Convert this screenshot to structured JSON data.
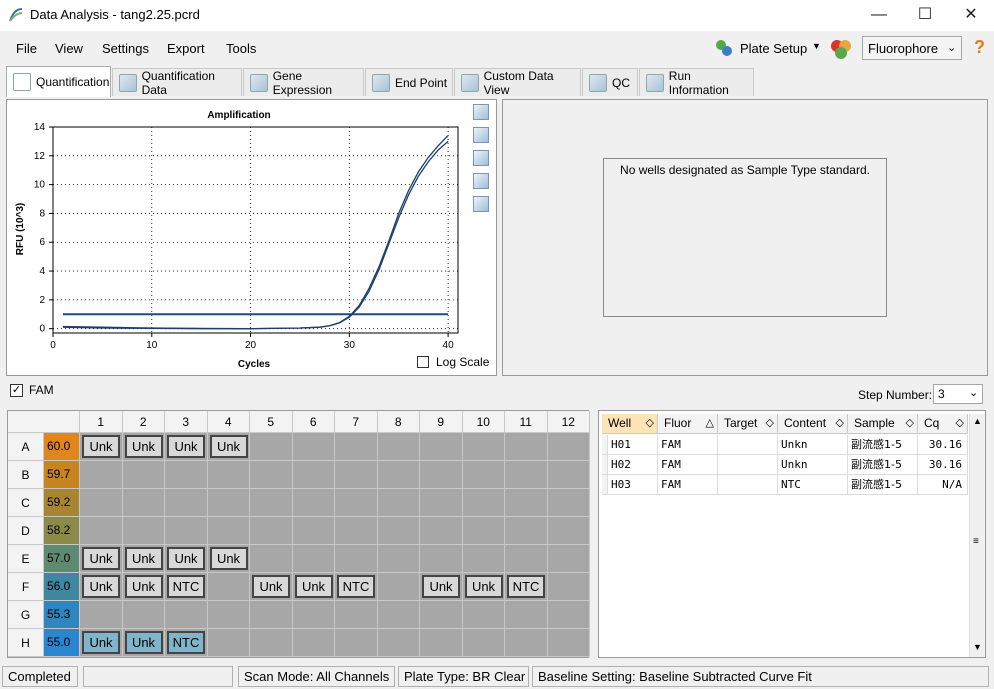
{
  "window": {
    "title": "Data Analysis - tang2.25.pcrd",
    "minimize": "—",
    "maximize": "☐",
    "close": "✕"
  },
  "menu": [
    "File",
    "View",
    "Settings",
    "Export",
    "Tools"
  ],
  "toolbar": {
    "plate_setup": "Plate Setup",
    "fluorophore": "Fluorophore",
    "help": "?"
  },
  "tabs": [
    "Quantification",
    "Quantification Data",
    "Gene Expression",
    "End Point",
    "Custom Data View",
    "QC",
    "Run Information"
  ],
  "chart_data": {
    "type": "line",
    "title": "Amplification",
    "xlabel": "Cycles",
    "ylabel": "RFU (10^3)",
    "xlim": [
      0,
      41
    ],
    "ylim": [
      -0.3,
      14
    ],
    "x_ticks": [
      0,
      10,
      20,
      30,
      40
    ],
    "y_ticks": [
      0,
      2,
      4,
      6,
      8,
      10,
      12,
      14
    ],
    "grid": true,
    "threshold": 1.0,
    "series": [
      {
        "x": [
          1,
          5,
          10,
          15,
          20,
          25,
          27,
          28,
          29,
          30,
          31,
          32,
          33,
          34,
          35,
          36,
          37,
          38,
          39,
          40
        ],
        "y": [
          0.1,
          0.05,
          0.02,
          0.0,
          0.0,
          0.05,
          0.1,
          0.2,
          0.4,
          0.8,
          1.5,
          2.6,
          4.1,
          5.9,
          7.7,
          9.3,
          10.6,
          11.6,
          12.4,
          13.0
        ]
      },
      {
        "x": [
          1,
          5,
          10,
          15,
          20,
          25,
          27,
          28,
          29,
          30,
          31,
          32,
          33,
          34,
          35,
          36,
          37,
          38,
          39,
          40
        ],
        "y": [
          0.15,
          0.1,
          0.05,
          0.02,
          0.0,
          0.05,
          0.1,
          0.2,
          0.42,
          0.85,
          1.6,
          2.8,
          4.3,
          6.1,
          8.0,
          9.6,
          10.9,
          11.9,
          12.7,
          13.4
        ]
      }
    ]
  },
  "log_scale_label": "Log Scale",
  "standard_message": "No wells designated as Sample Type standard.",
  "fam": {
    "label": "FAM",
    "checked": true
  },
  "step_number": {
    "label": "Step Number:",
    "value": "3"
  },
  "plate": {
    "columns": [
      "1",
      "2",
      "3",
      "4",
      "5",
      "6",
      "7",
      "8",
      "9",
      "10",
      "11",
      "12"
    ],
    "rows": [
      {
        "label": "A",
        "temp": "60.0",
        "color": "#e0861c",
        "wells": [
          "Unk",
          "Unk",
          "Unk",
          "Unk",
          "",
          "",
          "",
          "",
          "",
          "",
          "",
          ""
        ]
      },
      {
        "label": "B",
        "temp": "59.7",
        "color": "#c7851f",
        "wells": [
          "",
          "",
          "",
          "",
          "",
          "",
          "",
          "",
          "",
          "",
          "",
          ""
        ]
      },
      {
        "label": "C",
        "temp": "59.2",
        "color": "#a88631",
        "wells": [
          "",
          "",
          "",
          "",
          "",
          "",
          "",
          "",
          "",
          "",
          "",
          ""
        ]
      },
      {
        "label": "D",
        "temp": "58.2",
        "color": "#8c8a49",
        "wells": [
          "",
          "",
          "",
          "",
          "",
          "",
          "",
          "",
          "",
          "",
          "",
          ""
        ]
      },
      {
        "label": "E",
        "temp": "57.0",
        "color": "#5f8a72",
        "wells": [
          "Unk",
          "Unk",
          "Unk",
          "Unk",
          "",
          "",
          "",
          "",
          "",
          "",
          "",
          ""
        ]
      },
      {
        "label": "F",
        "temp": "56.0",
        "color": "#3f87a0",
        "wells": [
          "Unk",
          "Unk",
          "NTC",
          "",
          "Unk",
          "Unk",
          "NTC",
          "",
          "Unk",
          "Unk",
          "NTC",
          ""
        ]
      },
      {
        "label": "G",
        "temp": "55.3",
        "color": "#2d86c0",
        "wells": [
          "",
          "",
          "",
          "",
          "",
          "",
          "",
          "",
          "",
          "",
          "",
          ""
        ]
      },
      {
        "label": "H",
        "temp": "55.0",
        "color": "#2a86cf",
        "wells": [
          "Unk",
          "Unk",
          "NTC",
          "",
          "",
          "",
          "",
          "",
          "",
          "",
          "",
          ""
        ]
      }
    ]
  },
  "well_table": {
    "headers": [
      "Well",
      "Fluor",
      "Target",
      "Content",
      "Sample",
      "Cq"
    ],
    "rows": [
      [
        "H01",
        "FAM",
        "",
        "Unkn",
        "副流感1-5",
        "30.16"
      ],
      [
        "H02",
        "FAM",
        "",
        "Unkn",
        "副流感1-5",
        "30.16"
      ],
      [
        "H03",
        "FAM",
        "",
        "NTC",
        "副流感1-5",
        "N/A"
      ]
    ]
  },
  "status": {
    "state": "Completed",
    "scan_mode": "Scan Mode: All Channels",
    "plate_type": "Plate Type: BR Clear",
    "baseline": "Baseline Setting: Baseline Subtracted Curve Fit"
  },
  "colors": {
    "curve": "#1c3f6e",
    "threshold": "#1e4a86",
    "selected_well": "#7fb5c9"
  }
}
